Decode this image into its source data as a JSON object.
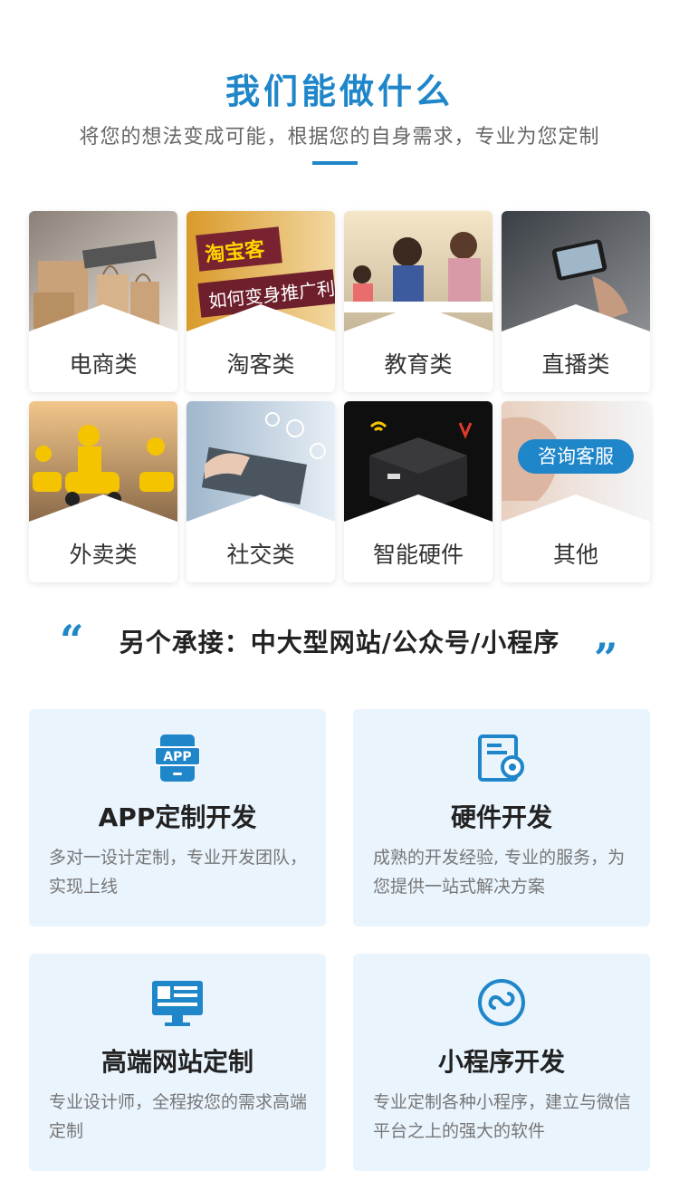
{
  "header": {
    "title": "我们能做什么",
    "subtitle": "将您的想法变成可能，根据您的自身需求，专业为您定制"
  },
  "categories": [
    {
      "label": "电商类",
      "icon": "shopping-bags-image"
    },
    {
      "label": "淘客类",
      "icon": "taobao-banner-image",
      "banner_top": "淘宝客",
      "banner_bottom": "如何变身推广利"
    },
    {
      "label": "教育类",
      "icon": "children-painting-image"
    },
    {
      "label": "直播类",
      "icon": "phone-live-image"
    },
    {
      "label": "外卖类",
      "icon": "delivery-riders-image"
    },
    {
      "label": "社交类",
      "icon": "laptop-social-image"
    },
    {
      "label": "智能硬件",
      "icon": "smart-device-image"
    },
    {
      "label": "其他",
      "icon": "customer-service-image",
      "badge": "咨询客服"
    }
  ],
  "quote": {
    "text": "另个承接：中大型网站/公众号/小程序",
    "open_mark": "“",
    "close_mark": "”"
  },
  "services": [
    {
      "title": "APP定制开发",
      "desc": "多对一设计定制，专业开发团队，实现上线",
      "icon": "app-phone-icon",
      "icon_text": "APP"
    },
    {
      "title": "硬件开发",
      "desc": "成熟的开发经验, 专业的服务，为您提供一站式解决方案",
      "icon": "hardware-gear-icon"
    },
    {
      "title": "高端网站定制",
      "desc": "专业设计师，全程按您的需求高端定制",
      "icon": "monitor-icon"
    },
    {
      "title": "小程序开发",
      "desc": "专业定制各种小程序，建立与微信平台之上的强大的软件",
      "icon": "mini-program-icon"
    }
  ],
  "colors": {
    "accent": "#1f86c9",
    "card_bg": "#eaf4fd"
  }
}
